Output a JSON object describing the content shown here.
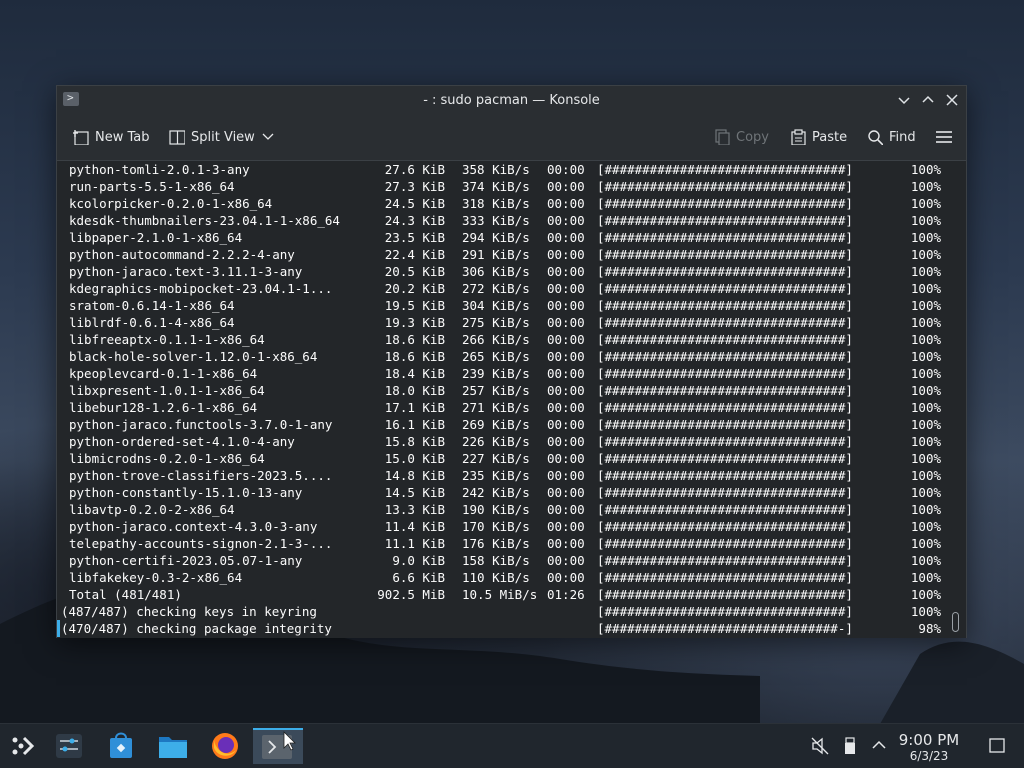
{
  "window": {
    "title": "- : sudo pacman — Konsole",
    "minimize_icon": "chevron-down",
    "maximize_icon": "chevron-up",
    "close_icon": "close"
  },
  "toolbar": {
    "new_tab": "New Tab",
    "split_view": "Split View",
    "copy": "Copy",
    "paste": "Paste",
    "find": "Find"
  },
  "terminal": {
    "packages": [
      {
        "name": "python-tomli-2.0.1-3-any",
        "size": "27.6 KiB",
        "rate": "358 KiB/s",
        "time": "00:00",
        "bar": "[################################]",
        "pct": "100%"
      },
      {
        "name": "run-parts-5.5-1-x86_64",
        "size": "27.3 KiB",
        "rate": "374 KiB/s",
        "time": "00:00",
        "bar": "[################################]",
        "pct": "100%"
      },
      {
        "name": "kcolorpicker-0.2.0-1-x86_64",
        "size": "24.5 KiB",
        "rate": "318 KiB/s",
        "time": "00:00",
        "bar": "[################################]",
        "pct": "100%"
      },
      {
        "name": "kdesdk-thumbnailers-23.04.1-1-x86_64",
        "size": "24.3 KiB",
        "rate": "333 KiB/s",
        "time": "00:00",
        "bar": "[################################]",
        "pct": "100%"
      },
      {
        "name": "libpaper-2.1.0-1-x86_64",
        "size": "23.5 KiB",
        "rate": "294 KiB/s",
        "time": "00:00",
        "bar": "[################################]",
        "pct": "100%"
      },
      {
        "name": "python-autocommand-2.2.2-4-any",
        "size": "22.4 KiB",
        "rate": "291 KiB/s",
        "time": "00:00",
        "bar": "[################################]",
        "pct": "100%"
      },
      {
        "name": "python-jaraco.text-3.11.1-3-any",
        "size": "20.5 KiB",
        "rate": "306 KiB/s",
        "time": "00:00",
        "bar": "[################################]",
        "pct": "100%"
      },
      {
        "name": "kdegraphics-mobipocket-23.04.1-1...",
        "size": "20.2 KiB",
        "rate": "272 KiB/s",
        "time": "00:00",
        "bar": "[################################]",
        "pct": "100%"
      },
      {
        "name": "sratom-0.6.14-1-x86_64",
        "size": "19.5 KiB",
        "rate": "304 KiB/s",
        "time": "00:00",
        "bar": "[################################]",
        "pct": "100%"
      },
      {
        "name": "liblrdf-0.6.1-4-x86_64",
        "size": "19.3 KiB",
        "rate": "275 KiB/s",
        "time": "00:00",
        "bar": "[################################]",
        "pct": "100%"
      },
      {
        "name": "libfreeaptx-0.1.1-1-x86_64",
        "size": "18.6 KiB",
        "rate": "266 KiB/s",
        "time": "00:00",
        "bar": "[################################]",
        "pct": "100%"
      },
      {
        "name": "black-hole-solver-1.12.0-1-x86_64",
        "size": "18.6 KiB",
        "rate": "265 KiB/s",
        "time": "00:00",
        "bar": "[################################]",
        "pct": "100%"
      },
      {
        "name": "kpeoplevcard-0.1-1-x86_64",
        "size": "18.4 KiB",
        "rate": "239 KiB/s",
        "time": "00:00",
        "bar": "[################################]",
        "pct": "100%"
      },
      {
        "name": "libxpresent-1.0.1-1-x86_64",
        "size": "18.0 KiB",
        "rate": "257 KiB/s",
        "time": "00:00",
        "bar": "[################################]",
        "pct": "100%"
      },
      {
        "name": "libebur128-1.2.6-1-x86_64",
        "size": "17.1 KiB",
        "rate": "271 KiB/s",
        "time": "00:00",
        "bar": "[################################]",
        "pct": "100%"
      },
      {
        "name": "python-jaraco.functools-3.7.0-1-any",
        "size": "16.1 KiB",
        "rate": "269 KiB/s",
        "time": "00:00",
        "bar": "[################################]",
        "pct": "100%"
      },
      {
        "name": "python-ordered-set-4.1.0-4-any",
        "size": "15.8 KiB",
        "rate": "226 KiB/s",
        "time": "00:00",
        "bar": "[################################]",
        "pct": "100%"
      },
      {
        "name": "libmicrodns-0.2.0-1-x86_64",
        "size": "15.0 KiB",
        "rate": "227 KiB/s",
        "time": "00:00",
        "bar": "[################################]",
        "pct": "100%"
      },
      {
        "name": "python-trove-classifiers-2023.5....",
        "size": "14.8 KiB",
        "rate": "235 KiB/s",
        "time": "00:00",
        "bar": "[################################]",
        "pct": "100%"
      },
      {
        "name": "python-constantly-15.1.0-13-any",
        "size": "14.5 KiB",
        "rate": "242 KiB/s",
        "time": "00:00",
        "bar": "[################################]",
        "pct": "100%"
      },
      {
        "name": "libavtp-0.2.0-2-x86_64",
        "size": "13.3 KiB",
        "rate": "190 KiB/s",
        "time": "00:00",
        "bar": "[################################]",
        "pct": "100%"
      },
      {
        "name": "python-jaraco.context-4.3.0-3-any",
        "size": "11.4 KiB",
        "rate": "170 KiB/s",
        "time": "00:00",
        "bar": "[################################]",
        "pct": "100%"
      },
      {
        "name": "telepathy-accounts-signon-2.1-3-...",
        "size": "11.1 KiB",
        "rate": "176 KiB/s",
        "time": "00:00",
        "bar": "[################################]",
        "pct": "100%"
      },
      {
        "name": "python-certifi-2023.05.07-1-any",
        "size": "9.0 KiB",
        "rate": "158 KiB/s",
        "time": "00:00",
        "bar": "[################################]",
        "pct": "100%"
      },
      {
        "name": "libfakekey-0.3-2-x86_64",
        "size": "6.6 KiB",
        "rate": "110 KiB/s",
        "time": "00:00",
        "bar": "[################################]",
        "pct": "100%"
      },
      {
        "name": "Total (481/481)",
        "size": "902.5 MiB",
        "rate": "10.5 MiB/s",
        "time": "01:26",
        "bar": "[################################]",
        "pct": "100%"
      }
    ],
    "status_lines": [
      {
        "text": "(487/487) checking keys in keyring",
        "bar": "[################################]",
        "pct": "100%"
      },
      {
        "text": "(470/487) checking package integrity",
        "bar": "[###############################-]",
        "pct": "98%"
      }
    ]
  },
  "taskbar": {
    "clock_time": "9:00 PM",
    "clock_date": "6/3/23",
    "apps": [
      "application-launcher-icon",
      "system-settings-icon",
      "discover-icon",
      "dolphin-icon",
      "firefox-icon",
      "konsole-icon"
    ]
  }
}
